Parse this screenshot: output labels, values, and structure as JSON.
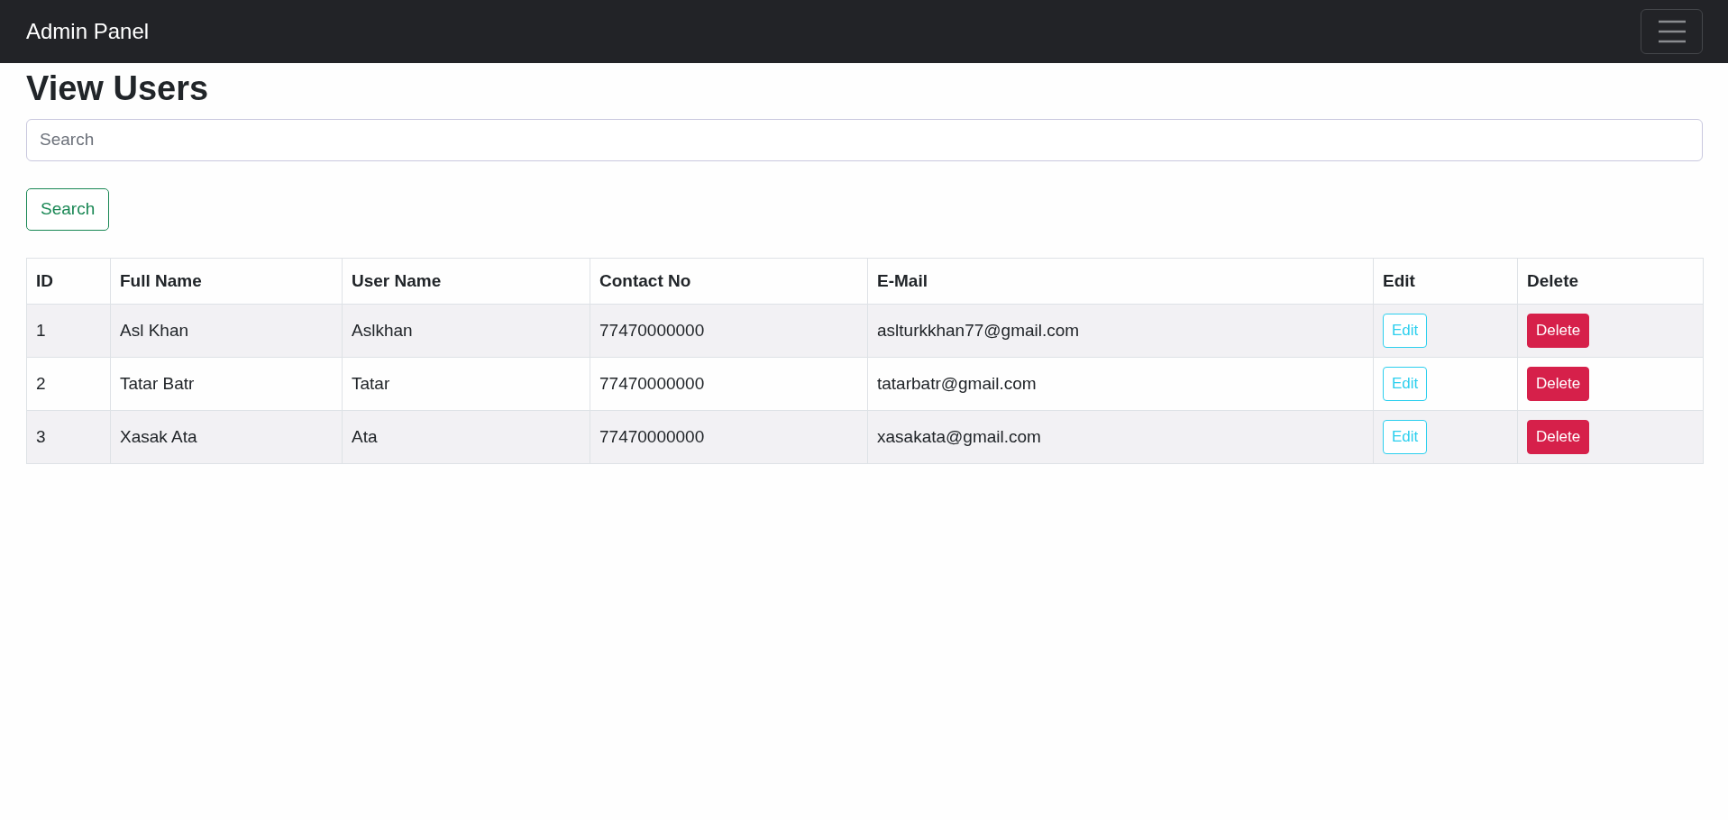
{
  "navbar": {
    "brand": "Admin Panel"
  },
  "heading": "View Users",
  "search": {
    "placeholder": "Search",
    "button": "Search"
  },
  "table": {
    "columns": [
      "ID",
      "Full Name",
      "User Name",
      "Contact No",
      "E-Mail",
      "Edit",
      "Delete"
    ],
    "rows": [
      {
        "id": "1",
        "full_name": "Asl Khan",
        "user_name": "Aslkhan",
        "contact": "77470000000",
        "email": "aslturkkhan77@gmail.com",
        "edit": "Edit",
        "delete": "Delete"
      },
      {
        "id": "2",
        "full_name": "Tatar Batr",
        "user_name": "Tatar",
        "contact": "77470000000",
        "email": "tatarbatr@gmail.com",
        "edit": "Edit",
        "delete": "Delete"
      },
      {
        "id": "3",
        "full_name": "Xasak Ata",
        "user_name": "Ata",
        "contact": "77470000000",
        "email": "xasakata@gmail.com",
        "edit": "Edit",
        "delete": "Delete"
      }
    ]
  }
}
